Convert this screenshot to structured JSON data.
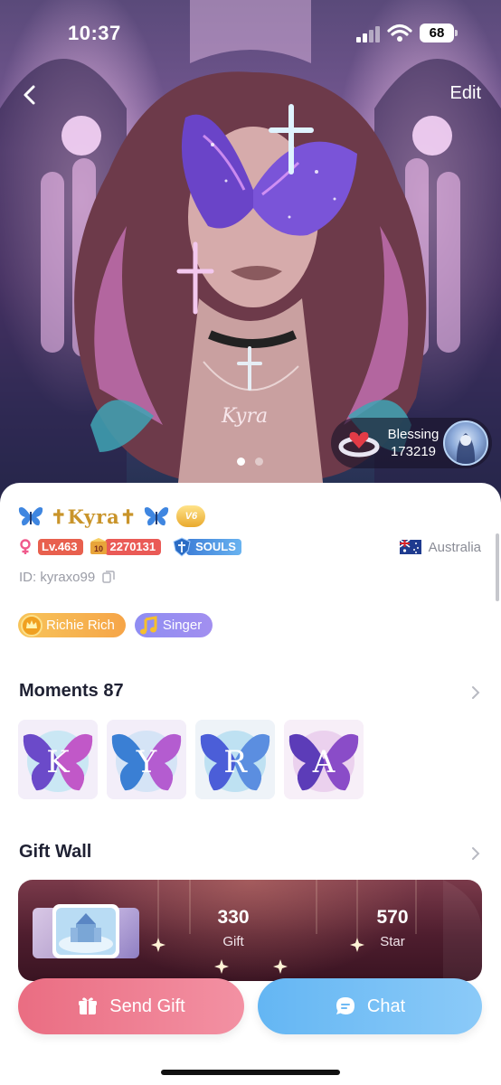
{
  "status_bar": {
    "time": "10:37",
    "battery": "68"
  },
  "header": {
    "edit_label": "Edit"
  },
  "hero": {
    "pendant_text": "Kyra",
    "blessing_label": "Blessing",
    "blessing_count": "173219",
    "page_count": 2,
    "active_page": 1
  },
  "profile": {
    "username": "✝Kyra✝",
    "vip_label": "V6",
    "level": "Lv.463",
    "wealth_rank_icon": "10",
    "wealth_value": "2270131",
    "family_name": "SOULS",
    "country": "Australia",
    "user_id": "ID: kyraxo99",
    "tags": [
      {
        "label": "Richie Rich",
        "icon": "crown-coin-icon"
      },
      {
        "label": "Singer",
        "icon": "music-note-icon"
      }
    ]
  },
  "moments": {
    "title": "Moments 87",
    "thumbnails": [
      {
        "letter": "K"
      },
      {
        "letter": "Y"
      },
      {
        "letter": "R"
      },
      {
        "letter": "A"
      }
    ]
  },
  "gift_wall": {
    "title": "Gift Wall",
    "gift_count": "330",
    "gift_label": "Gift",
    "star_count": "570",
    "star_label": "Star"
  },
  "actions": {
    "send_gift_label": "Send Gift",
    "chat_label": "Chat"
  },
  "colors": {
    "level_badge": "#e8604e",
    "send_gift": "#ea6d82",
    "chat": "#64b6f3",
    "username_gold": "#c9942a"
  }
}
